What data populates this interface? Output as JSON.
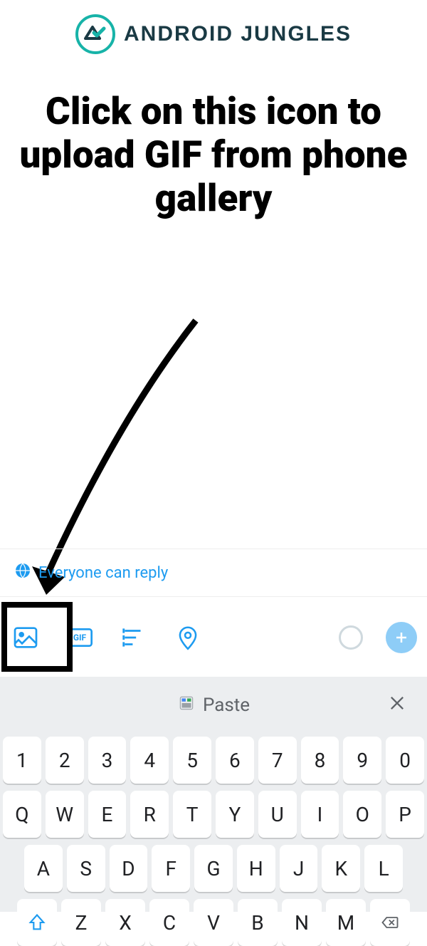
{
  "header": {
    "brand": "ANDROID JUNGLES"
  },
  "instruction": "Click on this icon to upload GIF from phone gallery",
  "reply": {
    "label": "Everyone can reply"
  },
  "toolbar": {
    "gif_label": "GIF"
  },
  "paste": {
    "label": "Paste"
  },
  "keyboard": {
    "row1": [
      "1",
      "2",
      "3",
      "4",
      "5",
      "6",
      "7",
      "8",
      "9",
      "0"
    ],
    "row2": [
      "Q",
      "W",
      "E",
      "R",
      "T",
      "Y",
      "U",
      "I",
      "O",
      "P"
    ],
    "row3": [
      "A",
      "S",
      "D",
      "F",
      "G",
      "H",
      "J",
      "K",
      "L"
    ],
    "row4": [
      "Z",
      "X",
      "C",
      "V",
      "B",
      "N",
      "M"
    ]
  }
}
